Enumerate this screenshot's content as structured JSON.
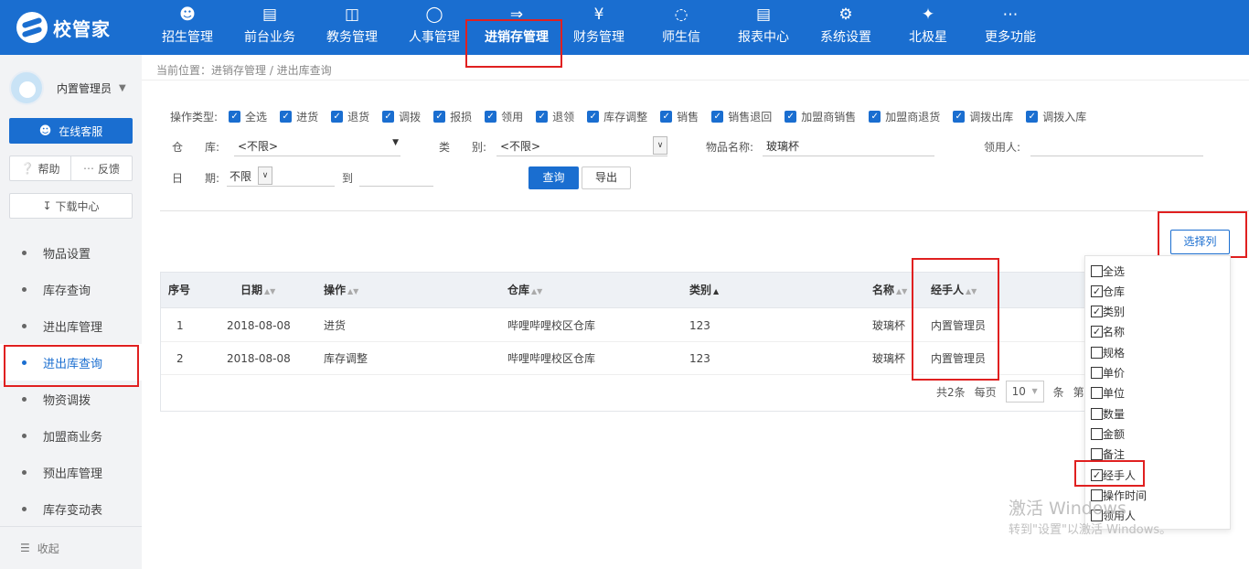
{
  "header": {
    "logo_text": "校管家",
    "nav": [
      {
        "icon": "user-add-icon",
        "label": "招生管理"
      },
      {
        "icon": "monitor-icon",
        "label": "前台业务"
      },
      {
        "icon": "book-icon",
        "label": "教务管理"
      },
      {
        "icon": "person-icon",
        "label": "人事管理"
      },
      {
        "icon": "inout-icon",
        "label": "进销存管理",
        "active": true
      },
      {
        "icon": "yen-icon",
        "label": "财务管理"
      },
      {
        "icon": "chat-icon",
        "label": "师生信"
      },
      {
        "icon": "report-icon",
        "label": "报表中心"
      },
      {
        "icon": "settings-icon",
        "label": "系统设置"
      },
      {
        "icon": "star-icon",
        "label": "北极星"
      },
      {
        "icon": "more-icon",
        "label": "更多功能"
      }
    ]
  },
  "sidebar": {
    "user_name": "内置管理员",
    "service_label": "在线客服",
    "help_label": "帮助",
    "feedback_label": "反馈",
    "download_label": "下载中心",
    "menu": [
      {
        "label": "物品设置"
      },
      {
        "label": "库存查询"
      },
      {
        "label": "进出库管理"
      },
      {
        "label": "进出库查询",
        "active": true
      },
      {
        "label": "物资调拨"
      },
      {
        "label": "加盟商业务"
      },
      {
        "label": "预出库管理"
      },
      {
        "label": "库存变动表"
      }
    ],
    "collapse_label": "收起"
  },
  "breadcrumb": "当前位置：进销存管理 / 进出库查询",
  "filters": {
    "op_type_label": "操作类型:",
    "op_types": [
      "全选",
      "进货",
      "退货",
      "调拨",
      "报损",
      "领用",
      "退领",
      "库存调整",
      "销售",
      "销售退回",
      "加盟商销售",
      "加盟商退货",
      "调拨出库",
      "调拨入库"
    ],
    "warehouse_label": "仓　　库:",
    "warehouse_value": "<不限>",
    "category_label": "类　　别:",
    "category_value": "<不限>",
    "item_name_label": "物品名称:",
    "item_name_value": "玻璃杯",
    "receiver_label": "领用人:",
    "receiver_value": "",
    "date_label": "日　　期:",
    "date_value": "不限",
    "to_label": "到",
    "query_label": "查询",
    "export_label": "导出"
  },
  "select_columns_label": "选择列",
  "table": {
    "headers": [
      "序号",
      "日期",
      "操作",
      "仓库",
      "类别",
      "名称",
      "经手人"
    ],
    "rows": [
      [
        "1",
        "2018-08-08",
        "进货",
        "哔哩哔哩校区仓库",
        "123",
        "玻璃杯",
        "内置管理员"
      ],
      [
        "2",
        "2018-08-08",
        "库存调整",
        "哔哩哔哩校区仓库",
        "123",
        "玻璃杯",
        "内置管理员"
      ]
    ],
    "pager": {
      "total": "共2条",
      "per_page": "每页",
      "page_size": "10",
      "unit": "条",
      "page_prefix": "第"
    }
  },
  "column_options": [
    {
      "label": "全选",
      "checked": false
    },
    {
      "label": "仓库",
      "checked": true
    },
    {
      "label": "类别",
      "checked": true
    },
    {
      "label": "名称",
      "checked": true
    },
    {
      "label": "规格",
      "checked": false
    },
    {
      "label": "单价",
      "checked": false
    },
    {
      "label": "单位",
      "checked": false
    },
    {
      "label": "数量",
      "checked": false
    },
    {
      "label": "金额",
      "checked": false
    },
    {
      "label": "备注",
      "checked": false
    },
    {
      "label": "经手人",
      "checked": true
    },
    {
      "label": "操作时间",
      "checked": false
    },
    {
      "label": "领用人",
      "checked": false
    }
  ],
  "watermark": {
    "line1": "激活 Windows",
    "line2": "转到\"设置\"以激活 Windows。"
  },
  "colors": {
    "primary": "#1a6ed0",
    "highlight": "#e02020"
  }
}
